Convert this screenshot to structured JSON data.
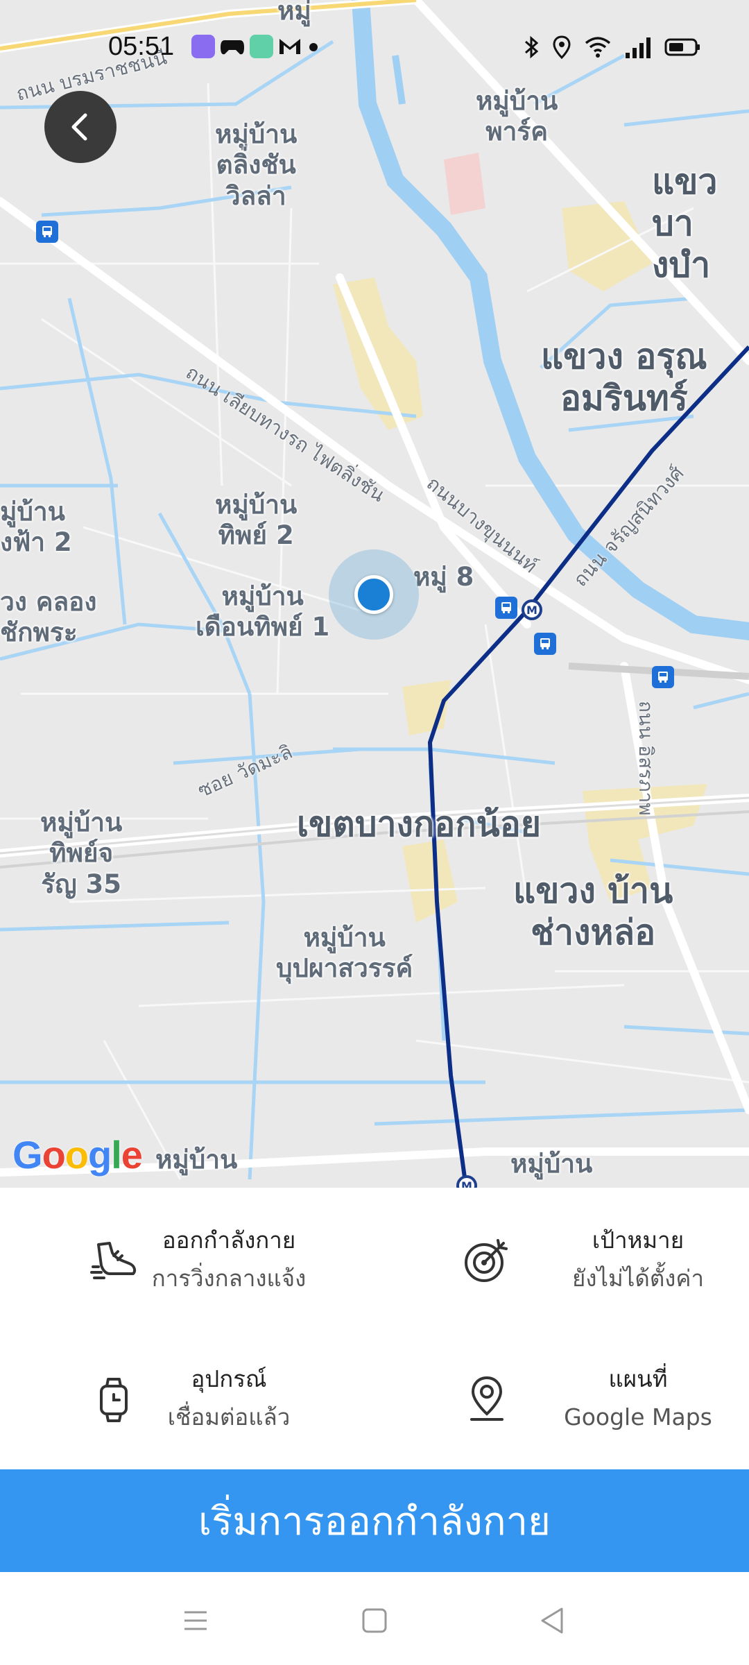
{
  "status_bar": {
    "time": "05:51",
    "colors": {
      "app1": "#8a6cf0",
      "app3": "#5fd0a7"
    }
  },
  "map": {
    "labels": {
      "village_top": "หมู่",
      "village_tlingchan": "หมู่บ้าน\nตลิ่งชัน\nวิลล่า",
      "village_park": "หมู่บ้าน\nพาร์ค",
      "district_khwaeng_top": "แขว\nบางบำ",
      "district_arun": "แขวง อรุณ\nอมรินทร์",
      "village_left_1": "มู่บ้าน\nงฟ้า 2",
      "village_thip2": "หมู่บ้าน\nทิพย์ 2",
      "district_khlong": "วง คลอง\nชักพระ",
      "village_duenthip": "หมู่บ้าน\nเดือนทิพย์ 1",
      "village_moo8": "หมู่ 8",
      "village_thipchareun": "หมู่บ้าน\nทิพย์จ\nรัญ 35",
      "district_bangkoknoi": "เขตบางกอกน้อย",
      "district_bangchanglo": "แขวง บ้าน\nช่างหล่อ",
      "village_buppha": "หมู่บ้าน\nบุปผาสวรรค์",
      "village_bottom_left": "หมู่บ้าน",
      "village_bottom_right": "หมู่บ้าน"
    },
    "roads": {
      "borommaratchachonnani": "ถนน บรมราชชนนี",
      "rail_tlingchan": "ถนน เลียบทางรถ ไฟตลิ่งชัน",
      "bangkhunnon": "ถนนบางขุนนนท์",
      "charansanitwong": "ถนน จรัญสนิทวงศ์",
      "soi_watmali": "ซอย วัดมะลิ",
      "itsaraphap": "ถนน อิสรภาพ"
    },
    "provider_logo": "Google",
    "provider_logo_colors": [
      "#4285F4",
      "#EA4335",
      "#FBBC05",
      "#4285F4",
      "#34A853",
      "#EA4335"
    ]
  },
  "panel": {
    "exercise": {
      "title": "ออกกำลังกาย",
      "value": "การวิ่งกลางแจ้ง",
      "icon": "running-shoe-icon"
    },
    "goal": {
      "title": "เป้าหมาย",
      "value": "ยังไม่ได้ตั้งค่า",
      "icon": "target-icon"
    },
    "device": {
      "title": "อุปกรณ์",
      "value": "เชื่อมต่อแล้ว",
      "icon": "watch-icon"
    },
    "map": {
      "title": "แผนที่",
      "value": "Google Maps",
      "icon": "map-pin-icon"
    }
  },
  "start_button": {
    "label": "เริ่มการออกกำลังกาย",
    "color": "#3596f1"
  }
}
